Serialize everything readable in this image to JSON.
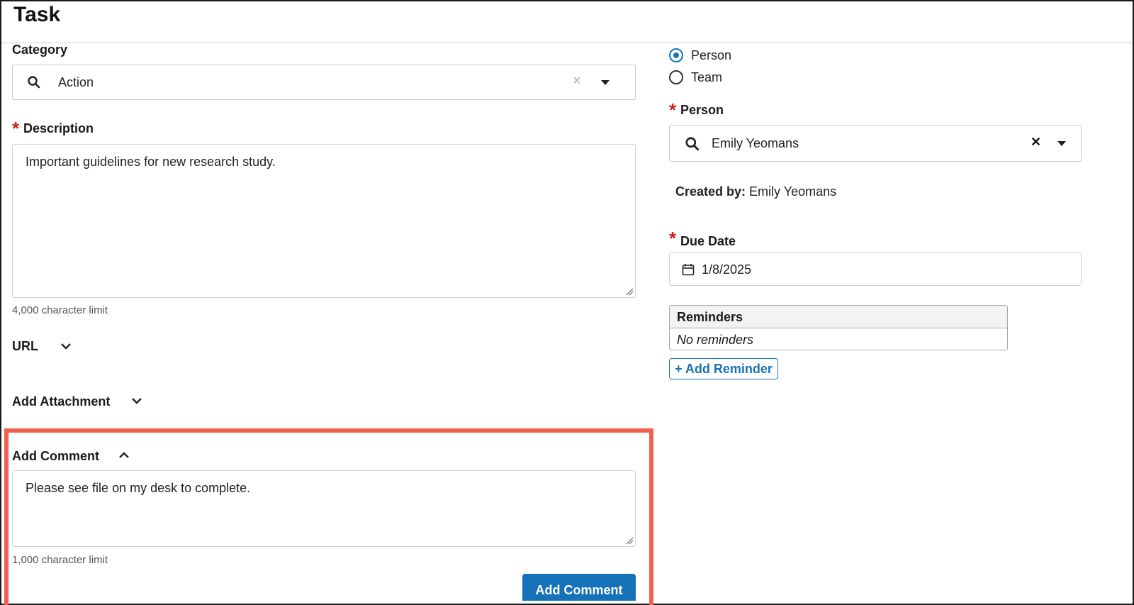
{
  "header": {
    "title": "Task"
  },
  "category": {
    "label": "Category",
    "value": "Action",
    "clear_symbol": "×",
    "icons": {
      "search": "search-icon",
      "clear": "close-icon",
      "dropdown": "caret-down-icon"
    }
  },
  "description": {
    "required_mark": "*",
    "label": "Description",
    "value": "Important guidelines for new research study.",
    "limit": "4,000 character limit"
  },
  "url_section": {
    "label": "URL",
    "icon": "chevron-down-icon"
  },
  "attachment_section": {
    "label": "Add Attachment",
    "icon": "chevron-down-icon"
  },
  "comment_section": {
    "label": "Add Comment",
    "icon": "chevron-up-icon",
    "value": "Please see file on my desk to complete.",
    "limit": "1,000 character limit",
    "button": "Add Comment",
    "highlight_color": "#f0614f"
  },
  "assignee_type": {
    "options": [
      {
        "label": "Person",
        "selected": true
      },
      {
        "label": "Team",
        "selected": false
      }
    ]
  },
  "person": {
    "required_mark": "*",
    "label": "Person",
    "value": "Emily Yeomans",
    "clear_symbol": "✕"
  },
  "created_by": {
    "label": "Created by:",
    "value": "Emily Yeomans"
  },
  "due_date": {
    "required_mark": "*",
    "label": "Due Date",
    "value": "1/8/2025",
    "icon": "calendar-icon"
  },
  "reminders": {
    "header": "Reminders",
    "empty_text": "No reminders",
    "add_button": "+ Add Reminder"
  },
  "colors": {
    "primary": "#1672b8",
    "required": "#d01f1f"
  }
}
